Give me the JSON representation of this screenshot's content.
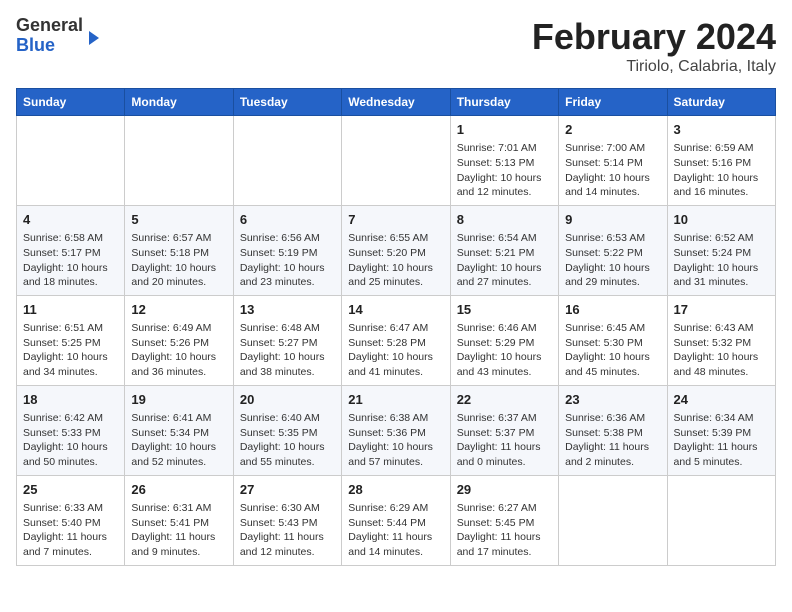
{
  "header": {
    "logo": {
      "line1": "General",
      "line2": "Blue"
    },
    "title": "February 2024",
    "location": "Tiriolo, Calabria, Italy"
  },
  "days_of_week": [
    "Sunday",
    "Monday",
    "Tuesday",
    "Wednesday",
    "Thursday",
    "Friday",
    "Saturday"
  ],
  "weeks": [
    [
      {
        "day": "",
        "info": ""
      },
      {
        "day": "",
        "info": ""
      },
      {
        "day": "",
        "info": ""
      },
      {
        "day": "",
        "info": ""
      },
      {
        "day": "1",
        "info": "Sunrise: 7:01 AM\nSunset: 5:13 PM\nDaylight: 10 hours\nand 12 minutes."
      },
      {
        "day": "2",
        "info": "Sunrise: 7:00 AM\nSunset: 5:14 PM\nDaylight: 10 hours\nand 14 minutes."
      },
      {
        "day": "3",
        "info": "Sunrise: 6:59 AM\nSunset: 5:16 PM\nDaylight: 10 hours\nand 16 minutes."
      }
    ],
    [
      {
        "day": "4",
        "info": "Sunrise: 6:58 AM\nSunset: 5:17 PM\nDaylight: 10 hours\nand 18 minutes."
      },
      {
        "day": "5",
        "info": "Sunrise: 6:57 AM\nSunset: 5:18 PM\nDaylight: 10 hours\nand 20 minutes."
      },
      {
        "day": "6",
        "info": "Sunrise: 6:56 AM\nSunset: 5:19 PM\nDaylight: 10 hours\nand 23 minutes."
      },
      {
        "day": "7",
        "info": "Sunrise: 6:55 AM\nSunset: 5:20 PM\nDaylight: 10 hours\nand 25 minutes."
      },
      {
        "day": "8",
        "info": "Sunrise: 6:54 AM\nSunset: 5:21 PM\nDaylight: 10 hours\nand 27 minutes."
      },
      {
        "day": "9",
        "info": "Sunrise: 6:53 AM\nSunset: 5:22 PM\nDaylight: 10 hours\nand 29 minutes."
      },
      {
        "day": "10",
        "info": "Sunrise: 6:52 AM\nSunset: 5:24 PM\nDaylight: 10 hours\nand 31 minutes."
      }
    ],
    [
      {
        "day": "11",
        "info": "Sunrise: 6:51 AM\nSunset: 5:25 PM\nDaylight: 10 hours\nand 34 minutes."
      },
      {
        "day": "12",
        "info": "Sunrise: 6:49 AM\nSunset: 5:26 PM\nDaylight: 10 hours\nand 36 minutes."
      },
      {
        "day": "13",
        "info": "Sunrise: 6:48 AM\nSunset: 5:27 PM\nDaylight: 10 hours\nand 38 minutes."
      },
      {
        "day": "14",
        "info": "Sunrise: 6:47 AM\nSunset: 5:28 PM\nDaylight: 10 hours\nand 41 minutes."
      },
      {
        "day": "15",
        "info": "Sunrise: 6:46 AM\nSunset: 5:29 PM\nDaylight: 10 hours\nand 43 minutes."
      },
      {
        "day": "16",
        "info": "Sunrise: 6:45 AM\nSunset: 5:30 PM\nDaylight: 10 hours\nand 45 minutes."
      },
      {
        "day": "17",
        "info": "Sunrise: 6:43 AM\nSunset: 5:32 PM\nDaylight: 10 hours\nand 48 minutes."
      }
    ],
    [
      {
        "day": "18",
        "info": "Sunrise: 6:42 AM\nSunset: 5:33 PM\nDaylight: 10 hours\nand 50 minutes."
      },
      {
        "day": "19",
        "info": "Sunrise: 6:41 AM\nSunset: 5:34 PM\nDaylight: 10 hours\nand 52 minutes."
      },
      {
        "day": "20",
        "info": "Sunrise: 6:40 AM\nSunset: 5:35 PM\nDaylight: 10 hours\nand 55 minutes."
      },
      {
        "day": "21",
        "info": "Sunrise: 6:38 AM\nSunset: 5:36 PM\nDaylight: 10 hours\nand 57 minutes."
      },
      {
        "day": "22",
        "info": "Sunrise: 6:37 AM\nSunset: 5:37 PM\nDaylight: 11 hours\nand 0 minutes."
      },
      {
        "day": "23",
        "info": "Sunrise: 6:36 AM\nSunset: 5:38 PM\nDaylight: 11 hours\nand 2 minutes."
      },
      {
        "day": "24",
        "info": "Sunrise: 6:34 AM\nSunset: 5:39 PM\nDaylight: 11 hours\nand 5 minutes."
      }
    ],
    [
      {
        "day": "25",
        "info": "Sunrise: 6:33 AM\nSunset: 5:40 PM\nDaylight: 11 hours\nand 7 minutes."
      },
      {
        "day": "26",
        "info": "Sunrise: 6:31 AM\nSunset: 5:41 PM\nDaylight: 11 hours\nand 9 minutes."
      },
      {
        "day": "27",
        "info": "Sunrise: 6:30 AM\nSunset: 5:43 PM\nDaylight: 11 hours\nand 12 minutes."
      },
      {
        "day": "28",
        "info": "Sunrise: 6:29 AM\nSunset: 5:44 PM\nDaylight: 11 hours\nand 14 minutes."
      },
      {
        "day": "29",
        "info": "Sunrise: 6:27 AM\nSunset: 5:45 PM\nDaylight: 11 hours\nand 17 minutes."
      },
      {
        "day": "",
        "info": ""
      },
      {
        "day": "",
        "info": ""
      }
    ]
  ]
}
